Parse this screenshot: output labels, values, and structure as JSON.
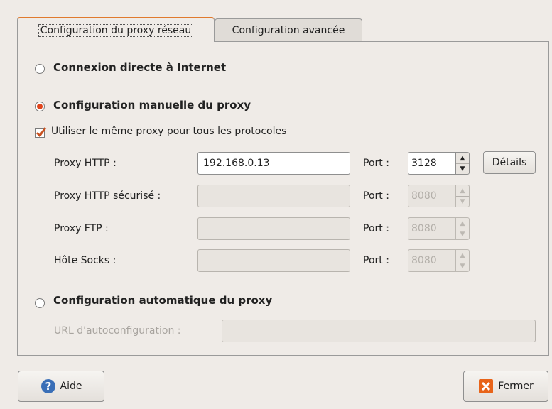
{
  "tabs": [
    {
      "label": "Configuration du proxy réseau",
      "active": true
    },
    {
      "label": "Configuration avancée",
      "active": false
    }
  ],
  "direct": {
    "label": "Connexion directe à Internet",
    "selected": false
  },
  "manual": {
    "label": "Configuration manuelle du proxy",
    "selected": true,
    "same_proxy_label": "Utiliser le même proxy pour tous les protocoles",
    "same_proxy_checked": true,
    "rows": [
      {
        "label": "Proxy HTTP :",
        "value": "192.168.0.13",
        "port_label": "Port :",
        "port": "3128",
        "enabled": true
      },
      {
        "label": "Proxy HTTP sécurisé :",
        "value": "",
        "port_label": "Port :",
        "port": "8080",
        "enabled": false
      },
      {
        "label": "Proxy FTP :",
        "value": "",
        "port_label": "Port :",
        "port": "8080",
        "enabled": false
      },
      {
        "label": "Hôte Socks :",
        "value": "",
        "port_label": "Port :",
        "port": "8080",
        "enabled": false
      }
    ],
    "details_label": "Détails"
  },
  "auto": {
    "label": "Configuration automatique du proxy",
    "selected": false,
    "url_label": "URL d'autoconfiguration :",
    "url_value": ""
  },
  "buttons": {
    "help": "Aide",
    "close": "Fermer"
  },
  "colors": {
    "accent": "#e07a2e",
    "radio_on": "#e0461d",
    "help_icon": "#3a6fb7",
    "close_icon": "#e8641a"
  }
}
